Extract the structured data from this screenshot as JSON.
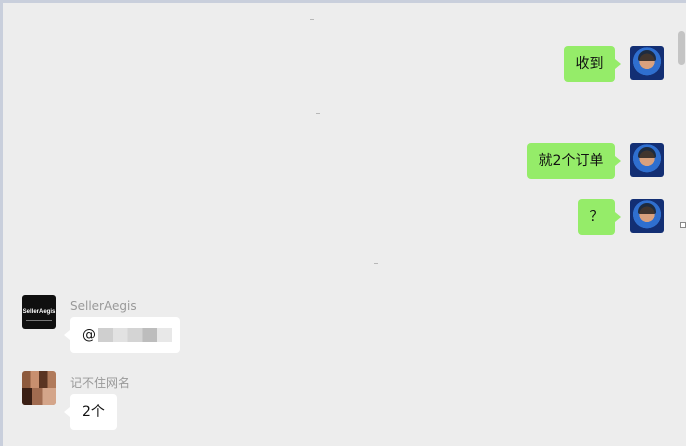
{
  "messages": [
    {
      "side": "self",
      "text": "收到"
    },
    {
      "side": "self",
      "text": "就2个订单"
    },
    {
      "side": "self",
      "text": "？"
    },
    {
      "side": "other",
      "sender": "SellerAegis",
      "text": "@",
      "avatar_text": "SellerAegis"
    },
    {
      "side": "other",
      "sender": "记不住网名",
      "text": "2个"
    }
  ],
  "colors": {
    "self_bubble": "#95ec69",
    "other_bubble": "#ffffff",
    "chat_background": "#ededed"
  }
}
